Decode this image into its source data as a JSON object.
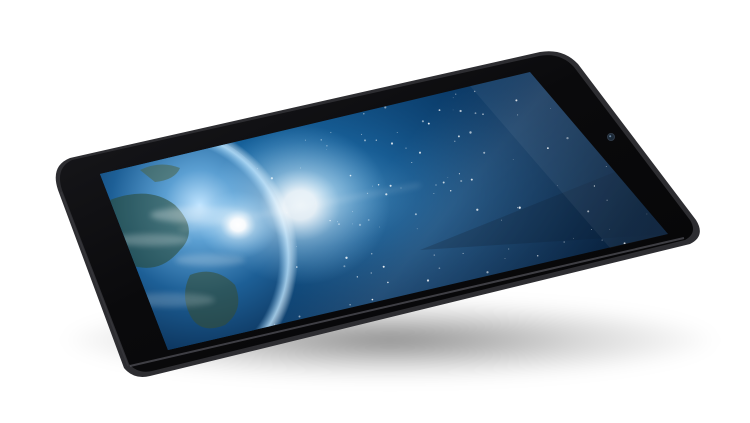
{
  "scene": {
    "subject": "tablet",
    "screen_wallpaper": "earth-from-space",
    "colors": {
      "background": "#ffffff",
      "bezel": "#0b0b0d",
      "frame_edge": "#3a3a3e",
      "space_deep": "#041326",
      "space_mid": "#0d4f86",
      "space_glow": "#5fb3e8",
      "earth_ocean": "#0b3e6e",
      "sun_glow": "#ffffff"
    }
  }
}
